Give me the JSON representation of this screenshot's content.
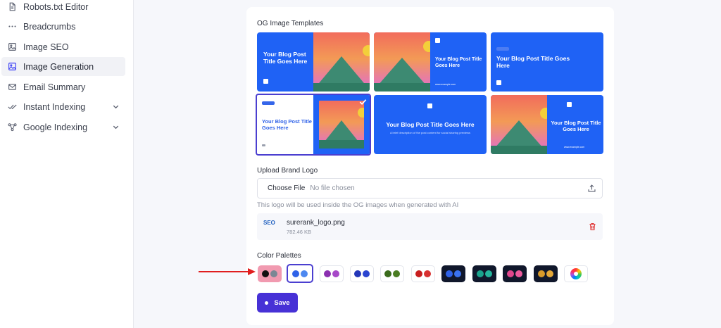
{
  "sidebar": {
    "items": [
      {
        "label": "Robots.txt Editor",
        "icon": "file-icon"
      },
      {
        "label": "Breadcrumbs",
        "icon": "dots-icon"
      },
      {
        "label": "Image SEO",
        "icon": "image-icon"
      },
      {
        "label": "Image Generation",
        "icon": "image-generation-icon",
        "active": true
      },
      {
        "label": "Email Summary",
        "icon": "mail-icon"
      },
      {
        "label": "Instant Indexing",
        "icon": "double-check-icon",
        "expandable": true
      },
      {
        "label": "Google Indexing",
        "icon": "network-icon",
        "expandable": true
      }
    ]
  },
  "og": {
    "section_label": "OG Image Templates",
    "templates": [
      {
        "title": "Your Blog Post Title Goes Here"
      },
      {
        "title": "Your Blog Post Title Goes Here",
        "url": "www.example.com"
      },
      {
        "title": "Your Blog Post Title Goes Here"
      },
      {
        "title": "Your Blog Post Title Goes Here",
        "selected": true
      },
      {
        "title": "Your Blog Post Title Goes Here",
        "desc": "A brief description of the post content for social sharing previews"
      },
      {
        "title": "Your Blog Post Title Goes Here",
        "url": "www.example.com"
      }
    ]
  },
  "upload": {
    "section_label": "Upload Brand Logo",
    "button_label": "Choose File",
    "no_file": "No file chosen",
    "hint": "This logo will be used inside the OG images when generated with AI",
    "file_name": "surerank_logo.png",
    "file_size": "782.46 KB",
    "thumb_text": "SEO"
  },
  "palettes": {
    "section_label": "Color Palettes",
    "items": [
      {
        "bg": "pink",
        "colors": [
          "#111111",
          "#7b8794"
        ]
      },
      {
        "bg": "white",
        "colors": [
          "#2f62e8",
          "#4d88f0"
        ],
        "selected": true
      },
      {
        "bg": "white",
        "colors": [
          "#8b2fb0",
          "#a748c8"
        ]
      },
      {
        "bg": "white",
        "colors": [
          "#2336b8",
          "#2a44d0"
        ]
      },
      {
        "bg": "white",
        "colors": [
          "#3a6b1c",
          "#4a7d22"
        ]
      },
      {
        "bg": "white",
        "colors": [
          "#c81e1e",
          "#d83030"
        ]
      },
      {
        "bg": "dark",
        "colors": [
          "#2f62e8",
          "#3a72f0"
        ]
      },
      {
        "bg": "dark",
        "colors": [
          "#1aa38c",
          "#24b59c"
        ]
      },
      {
        "bg": "dark",
        "colors": [
          "#e0468c",
          "#ec5a9c"
        ]
      },
      {
        "bg": "dark",
        "colors": [
          "#d89a2a",
          "#e4a838"
        ]
      },
      {
        "bg": "white",
        "wheel": true
      }
    ]
  },
  "save": {
    "label": "Save"
  },
  "colors": {
    "accent": "#4731d6",
    "template_blue": "#1f62f5",
    "annotation_arrow": "#e01e1e"
  }
}
